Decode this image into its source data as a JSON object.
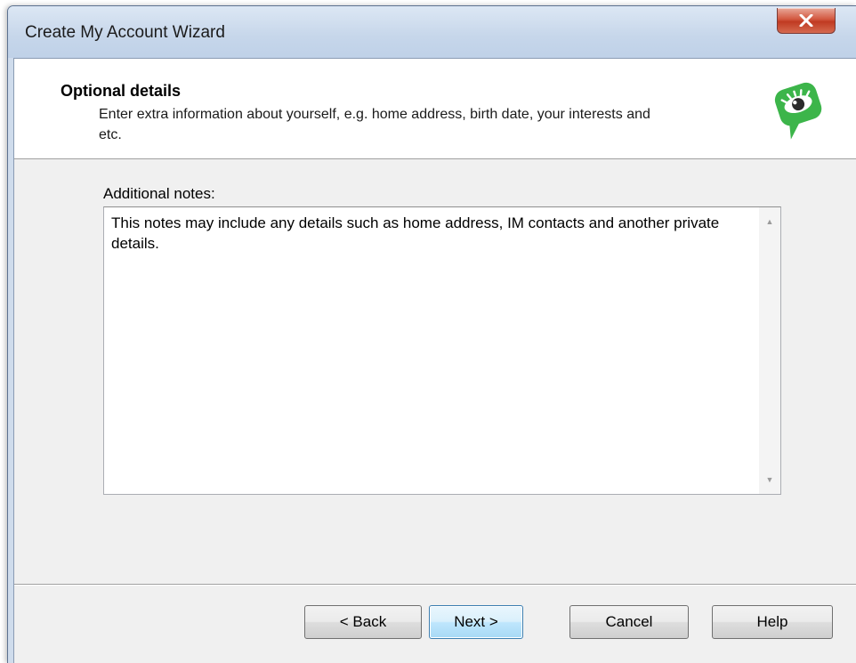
{
  "window": {
    "title": "Create My Account Wizard",
    "close_label": "x"
  },
  "header": {
    "title": "Optional details",
    "description": "Enter extra information about yourself, e.g. home address, birth date, your interests and etc.",
    "logo_icon": "speech-bubble-eye-icon",
    "accent_color": "#3cb54a"
  },
  "notes": {
    "label": "Additional notes:",
    "value": "This notes may include any details such as home address, IM contacts and another private details."
  },
  "buttons": {
    "back": "< Back",
    "next": "Next >",
    "cancel": "Cancel",
    "help": "Help"
  },
  "scrollbar": {
    "up_icon": "▲",
    "down_icon": "▼"
  }
}
